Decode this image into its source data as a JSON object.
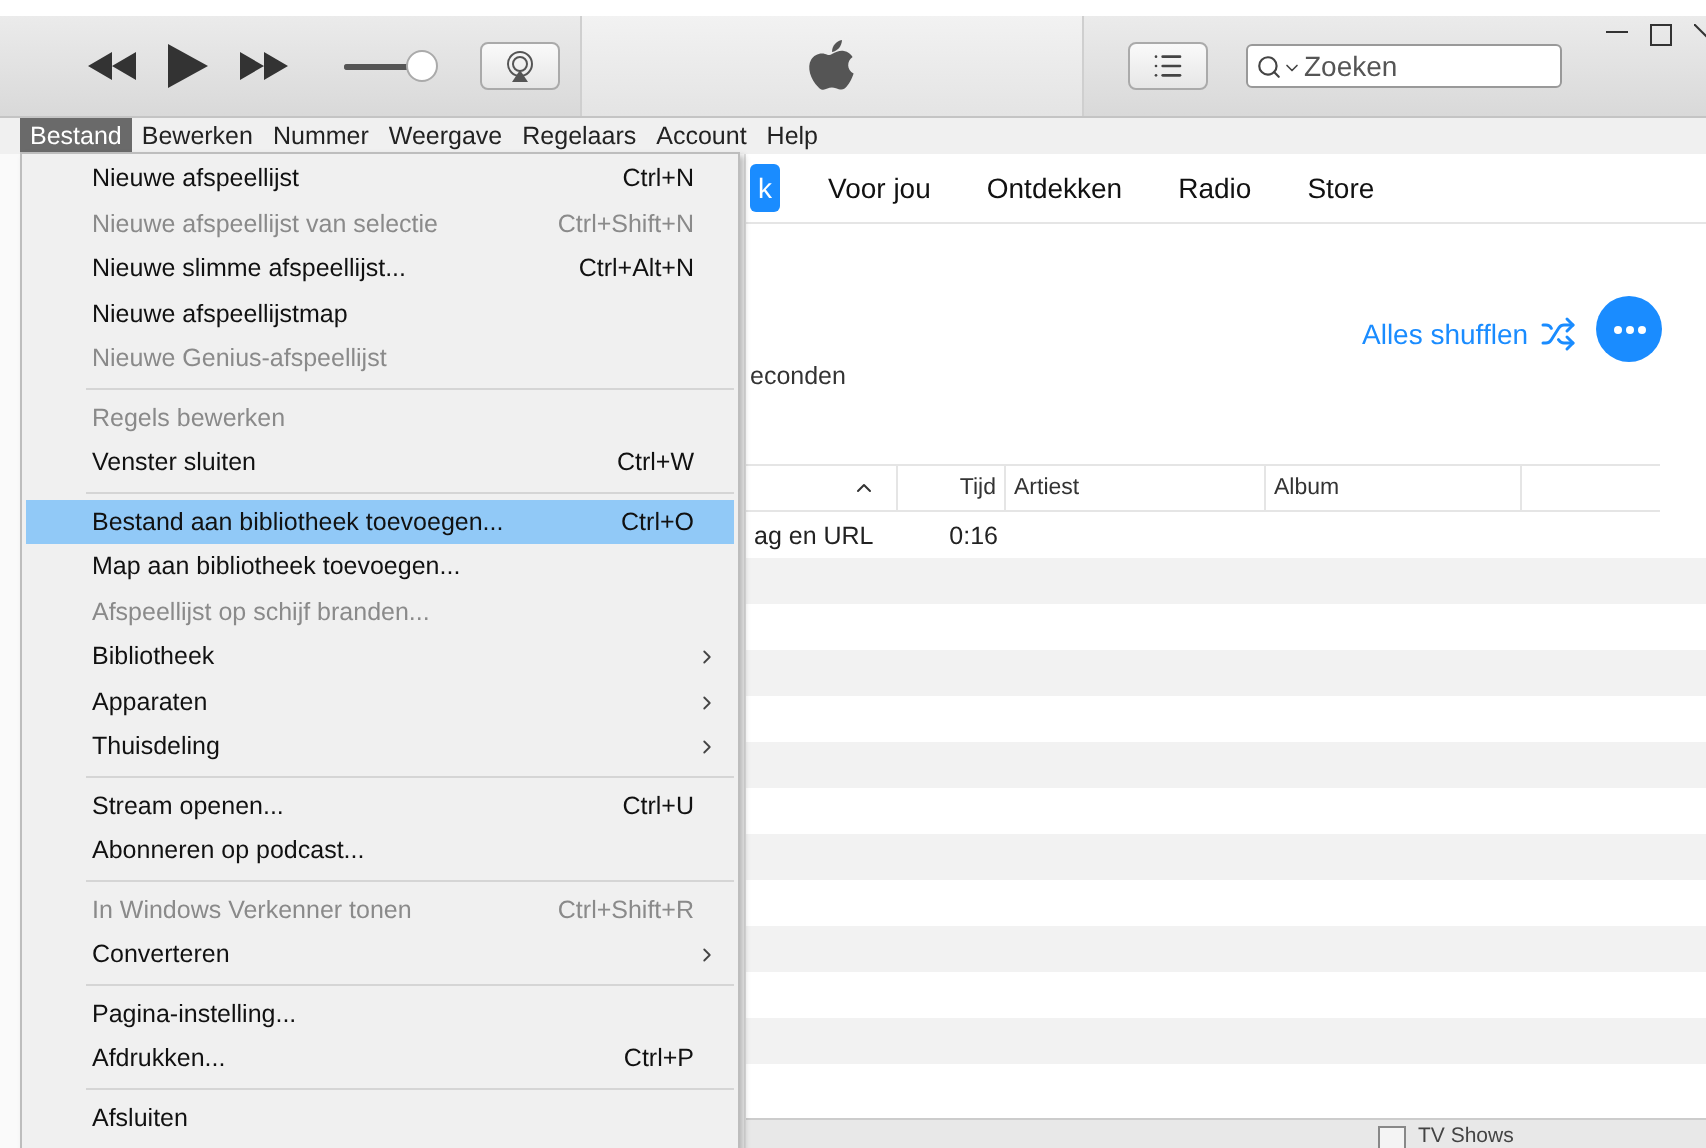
{
  "toolbar": {
    "volume": {
      "level": 0.85
    },
    "search": {
      "placeholder": "Zoeken"
    }
  },
  "menubar": [
    {
      "label": "Bestand",
      "selected": true
    },
    {
      "label": "Bewerken",
      "selected": false
    },
    {
      "label": "Nummer",
      "selected": false
    },
    {
      "label": "Weergave",
      "selected": false
    },
    {
      "label": "Regelaars",
      "selected": false
    },
    {
      "label": "Account",
      "selected": false
    },
    {
      "label": "Help",
      "selected": false
    }
  ],
  "nav_tabs": [
    {
      "label": "k",
      "selected": true
    },
    {
      "label": "Voor jou",
      "selected": false
    },
    {
      "label": "Ontdekken",
      "selected": false
    },
    {
      "label": "Radio",
      "selected": false
    },
    {
      "label": "Store",
      "selected": false
    }
  ],
  "playlist": {
    "info": "econden",
    "shuffle": "Alles shufflen"
  },
  "table": {
    "columns": [
      {},
      {
        "label": "Tijd"
      },
      {
        "label": "Artiest"
      },
      {
        "label": "Album"
      }
    ],
    "rows": [
      [
        "ag en URL",
        "0:16",
        "",
        ""
      ]
    ]
  },
  "bottom_bar": {
    "checkbox": {
      "label": "TV Shows",
      "checked": false
    }
  },
  "file_menu": [
    {
      "kind": "item",
      "label": "Nieuwe afspeellijst",
      "shortcut": "Ctrl+N",
      "disabled": false,
      "submenu": false,
      "selected": false
    },
    {
      "kind": "item",
      "label": "Nieuwe afspeellijst van selectie",
      "shortcut": "Ctrl+Shift+N",
      "disabled": true,
      "submenu": false,
      "selected": false
    },
    {
      "kind": "item",
      "label": "Nieuwe slimme afspeellijst...",
      "shortcut": "Ctrl+Alt+N",
      "disabled": false,
      "submenu": false,
      "selected": false
    },
    {
      "kind": "item",
      "label": "Nieuwe afspeellijstmap",
      "disabled": false,
      "submenu": false,
      "selected": false
    },
    {
      "kind": "item",
      "label": "Nieuwe Genius-afspeellijst",
      "disabled": true,
      "submenu": false,
      "selected": false
    },
    {
      "kind": "separator"
    },
    {
      "kind": "item",
      "label": "Regels bewerken",
      "disabled": true,
      "submenu": false,
      "selected": false
    },
    {
      "kind": "item",
      "label": "Venster sluiten",
      "shortcut": "Ctrl+W",
      "disabled": false,
      "submenu": false,
      "selected": false
    },
    {
      "kind": "separator"
    },
    {
      "kind": "item",
      "label": "Bestand aan bibliotheek toevoegen...",
      "shortcut": "Ctrl+O",
      "disabled": false,
      "submenu": false,
      "selected": true
    },
    {
      "kind": "item",
      "label": "Map aan bibliotheek toevoegen...",
      "disabled": false,
      "submenu": false,
      "selected": false
    },
    {
      "kind": "item",
      "label": "Afspeellijst op schijf branden...",
      "disabled": true,
      "submenu": false,
      "selected": false
    },
    {
      "kind": "item",
      "label": "Bibliotheek",
      "disabled": false,
      "submenu": true,
      "selected": false
    },
    {
      "kind": "item",
      "label": "Apparaten",
      "disabled": false,
      "submenu": true,
      "selected": false
    },
    {
      "kind": "item",
      "label": "Thuisdeling",
      "disabled": false,
      "submenu": true,
      "selected": false
    },
    {
      "kind": "separator"
    },
    {
      "kind": "item",
      "label": "Stream openen...",
      "shortcut": "Ctrl+U",
      "disabled": false,
      "submenu": false,
      "selected": false
    },
    {
      "kind": "item",
      "label": "Abonneren op podcast...",
      "disabled": false,
      "submenu": false,
      "selected": false
    },
    {
      "kind": "separator"
    },
    {
      "kind": "item",
      "label": "In Windows Verkenner tonen",
      "shortcut": "Ctrl+Shift+R",
      "disabled": true,
      "submenu": false,
      "selected": false
    },
    {
      "kind": "item",
      "label": "Converteren",
      "disabled": false,
      "submenu": true,
      "selected": false
    },
    {
      "kind": "separator"
    },
    {
      "kind": "item",
      "label": "Pagina-instelling...",
      "disabled": false,
      "submenu": false,
      "selected": false
    },
    {
      "kind": "item",
      "label": "Afdrukken...",
      "shortcut": "Ctrl+P",
      "disabled": false,
      "submenu": false,
      "selected": false
    },
    {
      "kind": "separator"
    },
    {
      "kind": "item",
      "label": "Afsluiten",
      "disabled": false,
      "submenu": false,
      "selected": false
    }
  ]
}
